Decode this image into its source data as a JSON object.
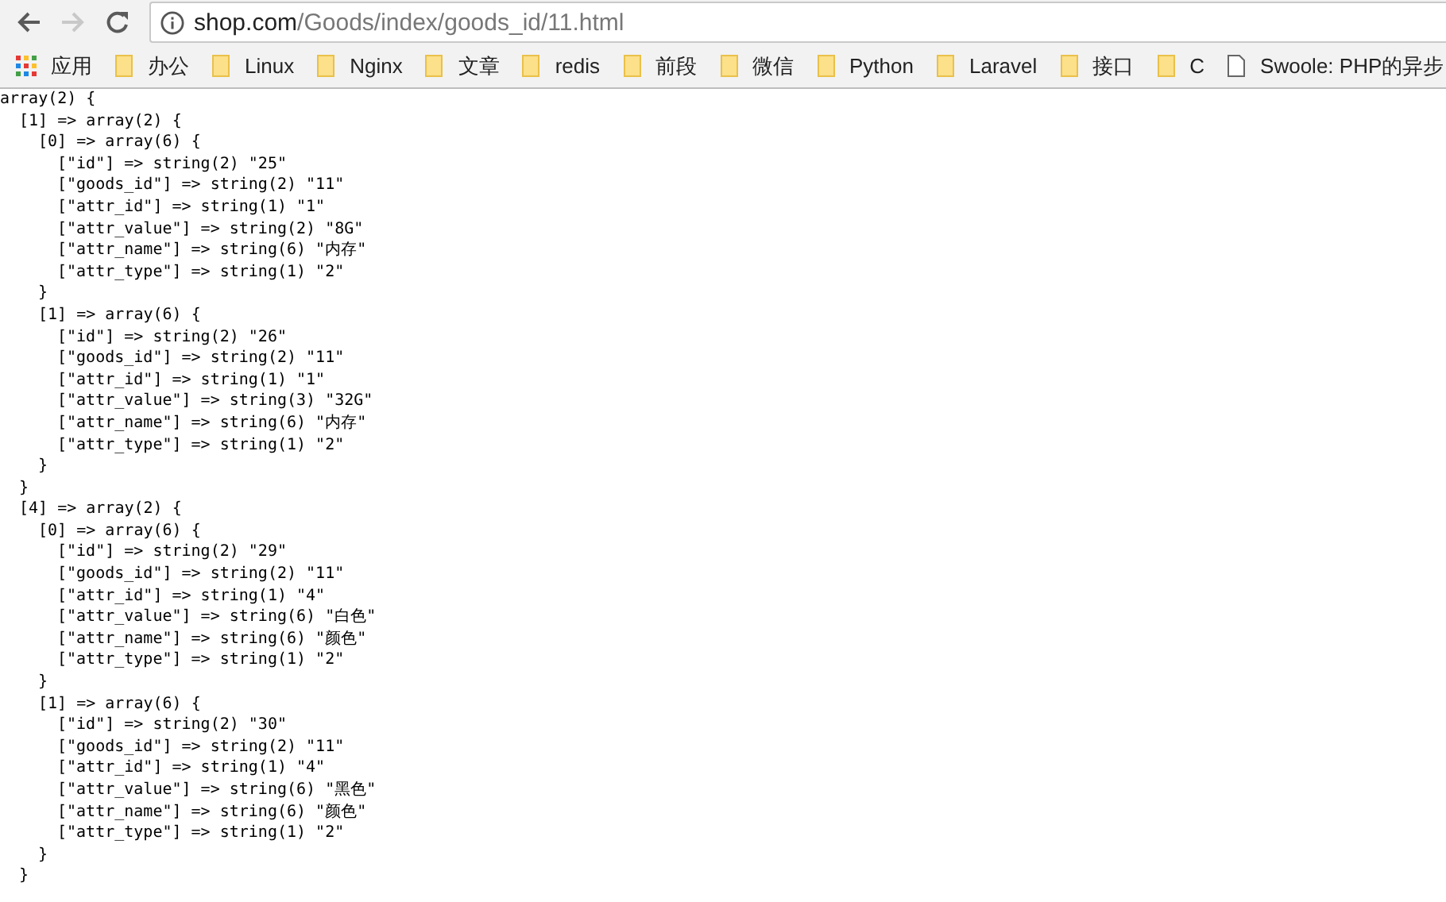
{
  "toolbar": {
    "nav_buttons": [
      {
        "kind": "back",
        "disabled": false
      },
      {
        "kind": "forward",
        "disabled": true
      },
      {
        "kind": "reload",
        "disabled": false
      }
    ],
    "address": {
      "host": "shop.com",
      "path": "/Goods/index/goods_id/11.html"
    }
  },
  "bookmarks": [
    {
      "kind": "apps",
      "label": "应用"
    },
    {
      "kind": "folder",
      "label": "办公"
    },
    {
      "kind": "folder",
      "label": "Linux"
    },
    {
      "kind": "folder",
      "label": "Nginx"
    },
    {
      "kind": "folder",
      "label": "文章"
    },
    {
      "kind": "folder",
      "label": "redis"
    },
    {
      "kind": "folder",
      "label": "前段"
    },
    {
      "kind": "folder",
      "label": "微信"
    },
    {
      "kind": "folder",
      "label": "Python"
    },
    {
      "kind": "folder",
      "label": "Laravel"
    },
    {
      "kind": "folder",
      "label": "接口"
    },
    {
      "kind": "folder",
      "label": "C"
    },
    {
      "kind": "page",
      "label": "Swoole: PHP的异步"
    }
  ],
  "dump": {
    "open": "array(2) {",
    "children": [
      {
        "open": "[1] => array(2) {",
        "close": "}",
        "children": [
          {
            "open": "[0] => array(6) {",
            "close": "}",
            "children": [
              {
                "text": "[\"id\"] => string(2) \"25\""
              },
              {
                "text": "[\"goods_id\"] => string(2) \"11\""
              },
              {
                "text": "[\"attr_id\"] => string(1) \"1\""
              },
              {
                "text": "[\"attr_value\"] => string(2) \"8G\""
              },
              {
                "text": "[\"attr_name\"] => string(6) \"内存\""
              },
              {
                "text": "[\"attr_type\"] => string(1) \"2\""
              }
            ]
          },
          {
            "open": "[1] => array(6) {",
            "close": "}",
            "children": [
              {
                "text": "[\"id\"] => string(2) \"26\""
              },
              {
                "text": "[\"goods_id\"] => string(2) \"11\""
              },
              {
                "text": "[\"attr_id\"] => string(1) \"1\""
              },
              {
                "text": "[\"attr_value\"] => string(3) \"32G\""
              },
              {
                "text": "[\"attr_name\"] => string(6) \"内存\""
              },
              {
                "text": "[\"attr_type\"] => string(1) \"2\""
              }
            ]
          }
        ]
      },
      {
        "open": "[4] => array(2) {",
        "close": "}",
        "children": [
          {
            "open": "[0] => array(6) {",
            "close": "}",
            "children": [
              {
                "text": "[\"id\"] => string(2) \"29\""
              },
              {
                "text": "[\"goods_id\"] => string(2) \"11\""
              },
              {
                "text": "[\"attr_id\"] => string(1) \"4\""
              },
              {
                "text": "[\"attr_value\"] => string(6) \"白色\""
              },
              {
                "text": "[\"attr_name\"] => string(6) \"颜色\""
              },
              {
                "text": "[\"attr_type\"] => string(1) \"2\""
              }
            ]
          },
          {
            "open": "[1] => array(6) {",
            "close": "}",
            "children": [
              {
                "text": "[\"id\"] => string(2) \"30\""
              },
              {
                "text": "[\"goods_id\"] => string(2) \"11\""
              },
              {
                "text": "[\"attr_id\"] => string(1) \"4\""
              },
              {
                "text": "[\"attr_value\"] => string(6) \"黑色\""
              },
              {
                "text": "[\"attr_name\"] => string(6) \"颜色\""
              },
              {
                "text": "[\"attr_type\"] => string(1) \"2\""
              }
            ]
          }
        ]
      }
    ]
  }
}
